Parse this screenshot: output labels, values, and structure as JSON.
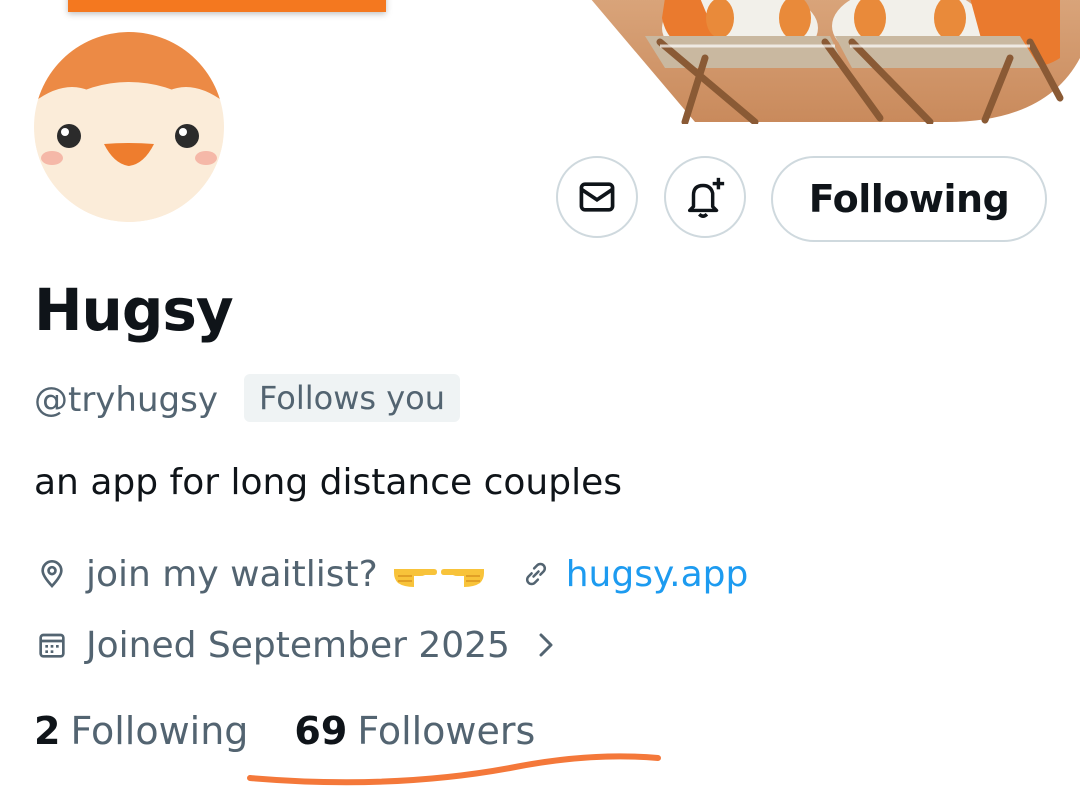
{
  "profile": {
    "display_name": "Hugsy",
    "handle": "@tryhugsy",
    "follows_you": "Follows you",
    "bio": "an app for long distance couples",
    "location": "join my waitlist?",
    "website": "hugsy.app",
    "joined": "Joined September 2025"
  },
  "actions": {
    "following_label": "Following"
  },
  "stats": {
    "following_count": "2",
    "following_label": "Following",
    "followers_count": "69",
    "followers_label": "Followers"
  },
  "icons": {
    "message": "envelope-icon",
    "notifications": "bell-plus-icon",
    "location": "location-pin-icon",
    "link": "link-icon",
    "calendar": "calendar-icon",
    "chevron": "chevron-right-icon"
  },
  "colors": {
    "accent_link": "#1d9bf0",
    "secondary_text": "#536471",
    "primary_text": "#0f1419",
    "border": "#cfd9de",
    "annotation": "#f4783a"
  }
}
